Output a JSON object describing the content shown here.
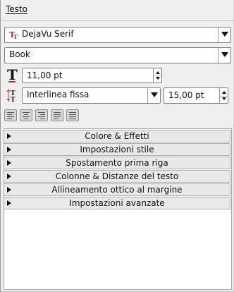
{
  "panel": {
    "title": "Testo"
  },
  "font": {
    "family": "DejaVu Serif",
    "style": "Book",
    "size": "11,00 pt",
    "line_spacing_mode": "Interlinea fissa",
    "line_spacing": "15,00 pt"
  },
  "icons": {
    "font_family_icon": "truetype-font-icon",
    "font_size_icon": "text-size-icon",
    "line_spacing_icon": "line-spacing-icon"
  },
  "alignment_buttons": [
    {
      "name": "align-left-button",
      "icon": "align-left-icon"
    },
    {
      "name": "align-center-button",
      "icon": "align-center-icon"
    },
    {
      "name": "align-right-button",
      "icon": "align-right-icon"
    },
    {
      "name": "align-justify-button",
      "icon": "align-justify-icon"
    },
    {
      "name": "align-forced-button",
      "icon": "align-forced-icon"
    }
  ],
  "sections": [
    {
      "label": "Colore & Effetti"
    },
    {
      "label": "Impostazioni stile"
    },
    {
      "label": "Spostamento prima riga"
    },
    {
      "label": "Colonne & Distanze del testo"
    },
    {
      "label": "Allineamento ottico al margine"
    },
    {
      "label": "Impostazioni avanzate"
    }
  ],
  "colors": {
    "accent_red": "#c0392b",
    "panel_bg": "#efefef"
  }
}
